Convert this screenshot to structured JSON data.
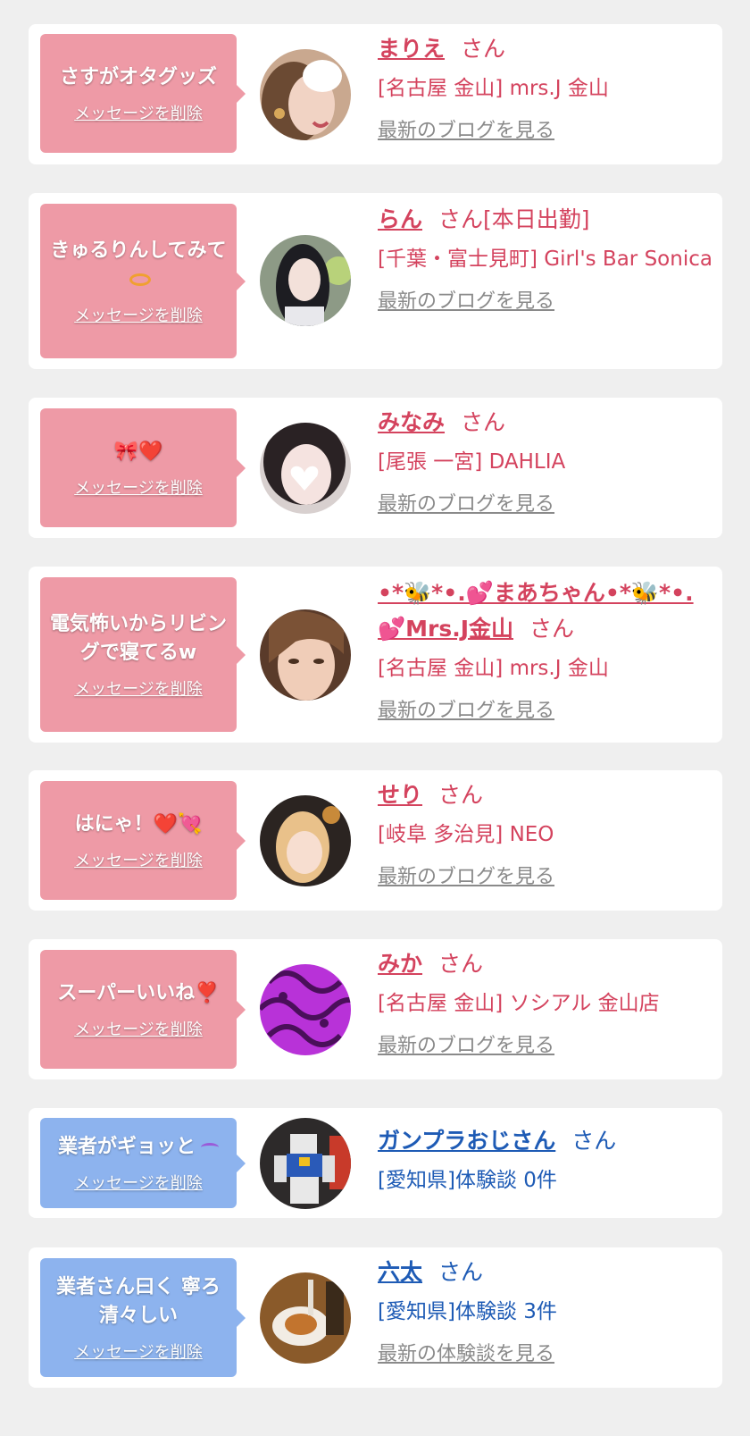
{
  "colors": {
    "page_bg": "#efefef",
    "card_bg": "#ffffff",
    "bubble_pink": "#ee9aa6",
    "bubble_blue": "#8db3ee",
    "name_pink": "#d4435e",
    "name_blue": "#1e5bb5",
    "link_gray": "#8a8a8a"
  },
  "cards": [
    {
      "bubble_text": "さすがオタグッズ",
      "delete_label": "メッセージを削除",
      "name": "まりえ",
      "suffix": "さん",
      "shop": "[名古屋 金山] mrs.J 金山",
      "link": "最新のブログを見る"
    },
    {
      "bubble_text": "きゅるりんしてみて",
      "bubble_emoji_icon": "ring-icon",
      "delete_label": "メッセージを削除",
      "name": "らん",
      "suffix": "さん[本日出勤]",
      "shop": "[千葉・富士見町] Girl's Bar Sonica",
      "link": "最新のブログを見る"
    },
    {
      "bubble_text": "🎀❤️",
      "delete_label": "メッセージを削除",
      "name": "みなみ",
      "suffix": "さん",
      "shop": "[尾張 一宮] DAHLIA",
      "link": "最新のブログを見る"
    },
    {
      "bubble_text": "電気怖いからリビングで寝てるw",
      "delete_label": "メッセージを削除",
      "name": "•*🐝*•.💕まあちゃん•*🐝*•.💕Mrs.J金山",
      "suffix": "さん",
      "shop": "[名古屋 金山] mrs.J 金山",
      "link": "最新のブログを見る"
    },
    {
      "bubble_text": "はにゃ！❤️💘",
      "delete_label": "メッセージを削除",
      "name": "せり",
      "suffix": "さん",
      "shop": "[岐阜 多治見] NEO",
      "link": "最新のブログを見る"
    },
    {
      "bubble_text": "スーパーいいね❣️",
      "delete_label": "メッセージを削除",
      "name": "みか",
      "suffix": "さん",
      "shop": "[名古屋 金山] ソシアル 金山店",
      "link": "最新のブログを見る"
    },
    {
      "bubble_text": "業者がギョッと",
      "bubble_emoji_icon": "smile-eyes-icon",
      "delete_label": "メッセージを削除",
      "name": "ガンプラおじさん",
      "suffix": "さん",
      "shop": "[愛知県]体験談 0件",
      "link": ""
    },
    {
      "bubble_text": "業者さん曰く 寧ろ清々しい",
      "delete_label": "メッセージを削除",
      "name": "六太",
      "suffix": "さん",
      "shop": "[愛知県]体験談 3件",
      "link": "最新の体験談を見る"
    }
  ]
}
